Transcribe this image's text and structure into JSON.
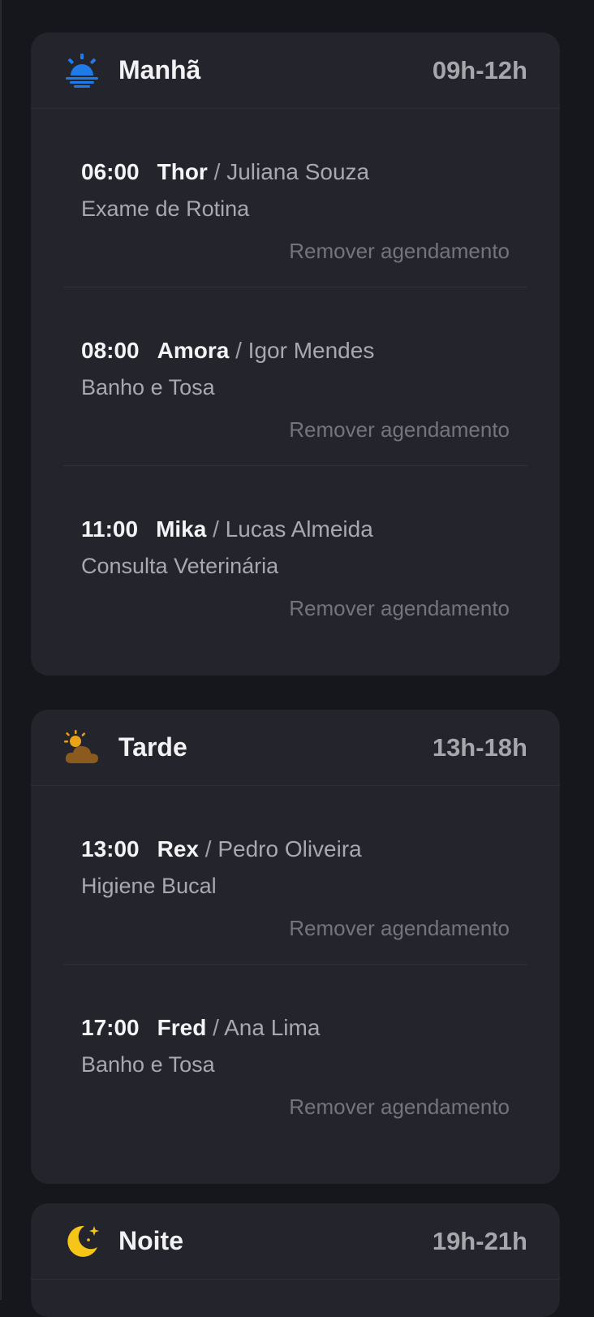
{
  "periods": [
    {
      "title": "Manhã",
      "range": "09h-12h",
      "icon": "sunrise-icon",
      "appointments": [
        {
          "time": "06:00",
          "pet": "Thor",
          "separator": "/",
          "owner": "Juliana Souza",
          "service": "Exame de Rotina",
          "remove_label": "Remover agendamento"
        },
        {
          "time": "08:00",
          "pet": "Amora",
          "separator": "/",
          "owner": "Igor Mendes",
          "service": "Banho e Tosa",
          "remove_label": "Remover agendamento"
        },
        {
          "time": "11:00",
          "pet": "Mika",
          "separator": "/",
          "owner": "Lucas Almeida",
          "service": "Consulta Veterinária",
          "remove_label": "Remover agendamento"
        }
      ]
    },
    {
      "title": "Tarde",
      "range": "13h-18h",
      "icon": "sun-cloud-icon",
      "appointments": [
        {
          "time": "13:00",
          "pet": "Rex",
          "separator": "/",
          "owner": "Pedro Oliveira",
          "service": "Higiene Bucal",
          "remove_label": "Remover agendamento"
        },
        {
          "time": "17:00",
          "pet": "Fred",
          "separator": "/",
          "owner": "Ana Lima",
          "service": "Banho e Tosa",
          "remove_label": "Remover agendamento"
        }
      ]
    },
    {
      "title": "Noite",
      "range": "19h-21h",
      "icon": "moon-icon",
      "appointments": []
    }
  ],
  "colors": {
    "background": "#16161d",
    "card": "#23242c",
    "morning_icon": "#1e7be8",
    "afternoon_sun": "#e8a317",
    "afternoon_cloud": "#8a5a1e",
    "night_icon": "#f5c518"
  }
}
